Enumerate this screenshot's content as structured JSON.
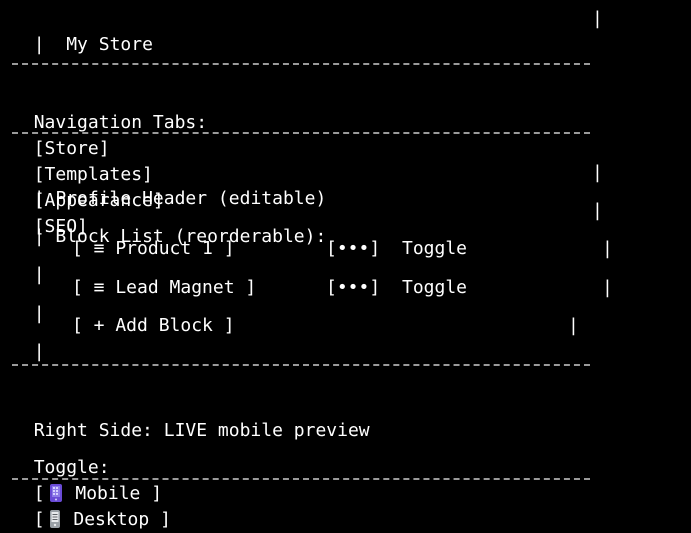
{
  "header": {
    "border_left": "|",
    "title": "My Store",
    "border_right": "|"
  },
  "separator": "--------------------------------------------",
  "navigation": {
    "label": "Navigation Tabs:",
    "tabs": [
      {
        "label": "[Store]"
      },
      {
        "label": "[Templates]"
      },
      {
        "label": "[Appearance]"
      },
      {
        "label": "[SEO]"
      }
    ]
  },
  "editor": {
    "pipe": "|",
    "profile_header": "Profile Header (editable)",
    "block_list_label": "Block List (reorderable):",
    "blocks": [
      {
        "label": "[ ≡ Product 1 ]",
        "menu": "[•••]",
        "toggle": "Toggle"
      },
      {
        "label": "[ ≡ Lead Magnet ]",
        "menu": "[•••]",
        "toggle": "Toggle"
      }
    ],
    "add_block": "[ + Add Block ]"
  },
  "preview": {
    "label": "Right Side: LIVE mobile preview",
    "toggle_label": "Toggle:",
    "open_bracket": "[",
    "close_bracket": "]",
    "mobile": "Mobile",
    "desktop": "Desktop",
    "mobile_icon": "mobile-phone-icon",
    "desktop_icon": "desktop-phone-icon"
  },
  "colors": {
    "background": "#000000",
    "text": "#ffffff",
    "mobile_icon": "#6a4bd6",
    "desktop_icon": "#9aa0a6"
  }
}
